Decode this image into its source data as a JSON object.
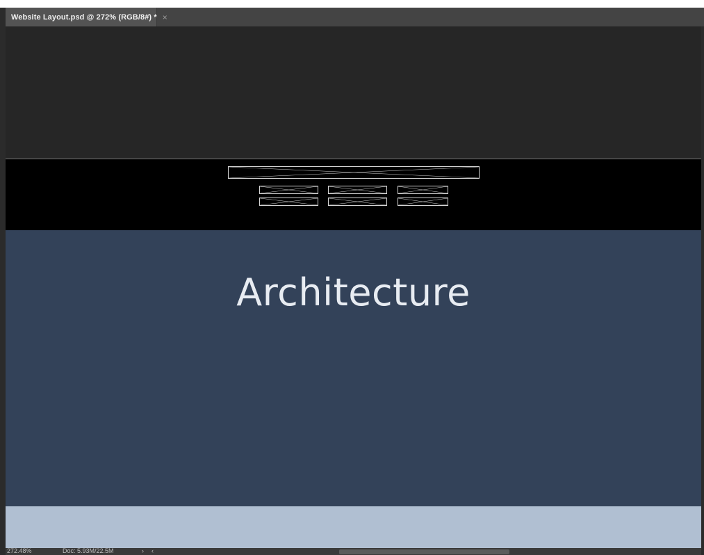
{
  "document_tab": {
    "title": "Website Layout.psd @ 272% (RGB/8#) *",
    "close_glyph": "×"
  },
  "hero": {
    "title": "Architecture",
    "background": "#334259",
    "text_color": "#e8ecf2"
  },
  "bands": {
    "pasteboard": "#262626",
    "header": "#000000",
    "footer": "#b0bfd2"
  },
  "statusbar": {
    "zoom": "272.48%",
    "doc_info": "Doc: 5.93M/22.5M",
    "arrow_glyph": "›",
    "scroll_left_glyph": "‹"
  },
  "placeholders": {
    "logo": "logo-placeholder-icon",
    "nav_items": [
      "nav-placeholder-icon",
      "nav-placeholder-icon",
      "nav-placeholder-icon",
      "nav-placeholder-icon",
      "nav-placeholder-icon",
      "nav-placeholder-icon"
    ]
  }
}
